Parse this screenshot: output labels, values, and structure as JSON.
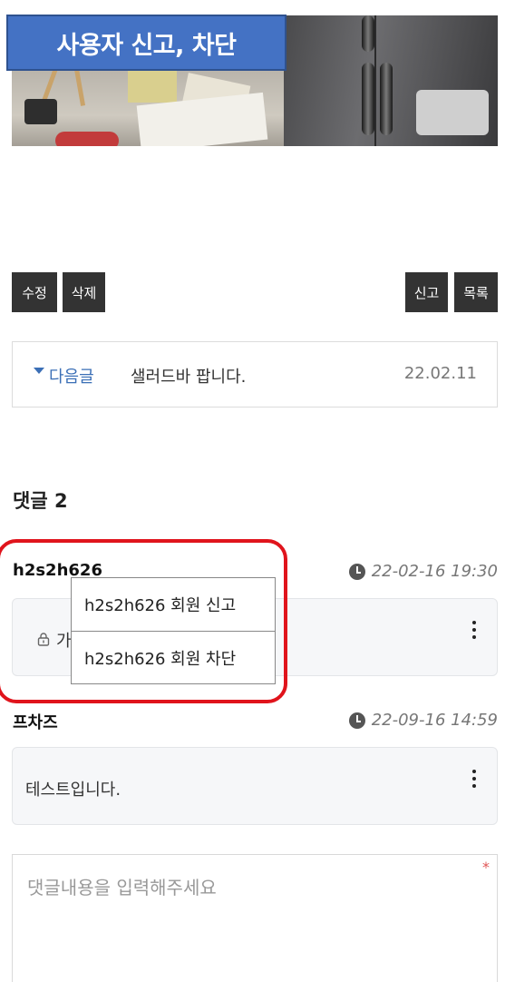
{
  "annotation": {
    "title": "사용자 신고, 차단"
  },
  "buttons": {
    "edit": "수정",
    "delete": "삭제",
    "report": "신고",
    "list": "목록"
  },
  "next_post": {
    "label": "다음글",
    "title": "샐러드바 팝니다.",
    "date": "22.02.11"
  },
  "comments_header": {
    "label": "댓글 2"
  },
  "comments": [
    {
      "author": "h2s2h626",
      "date": "22-02-16 19:30",
      "content_visible": "가"
    },
    {
      "author": "프차즈",
      "date": "22-09-16 14:59",
      "content": "테스트입니다."
    }
  ],
  "context_menu": {
    "items": [
      "h2s2h626 회원 신고",
      "h2s2h626 회원 차단"
    ]
  },
  "comment_form": {
    "placeholder": "댓글내용을 입력해주세요",
    "required_mark": "*"
  },
  "colors": {
    "label_bg": "#4472c4",
    "link_blue": "#3b6fb6",
    "highlight_red": "#e0141c",
    "button_dark": "#333333"
  }
}
